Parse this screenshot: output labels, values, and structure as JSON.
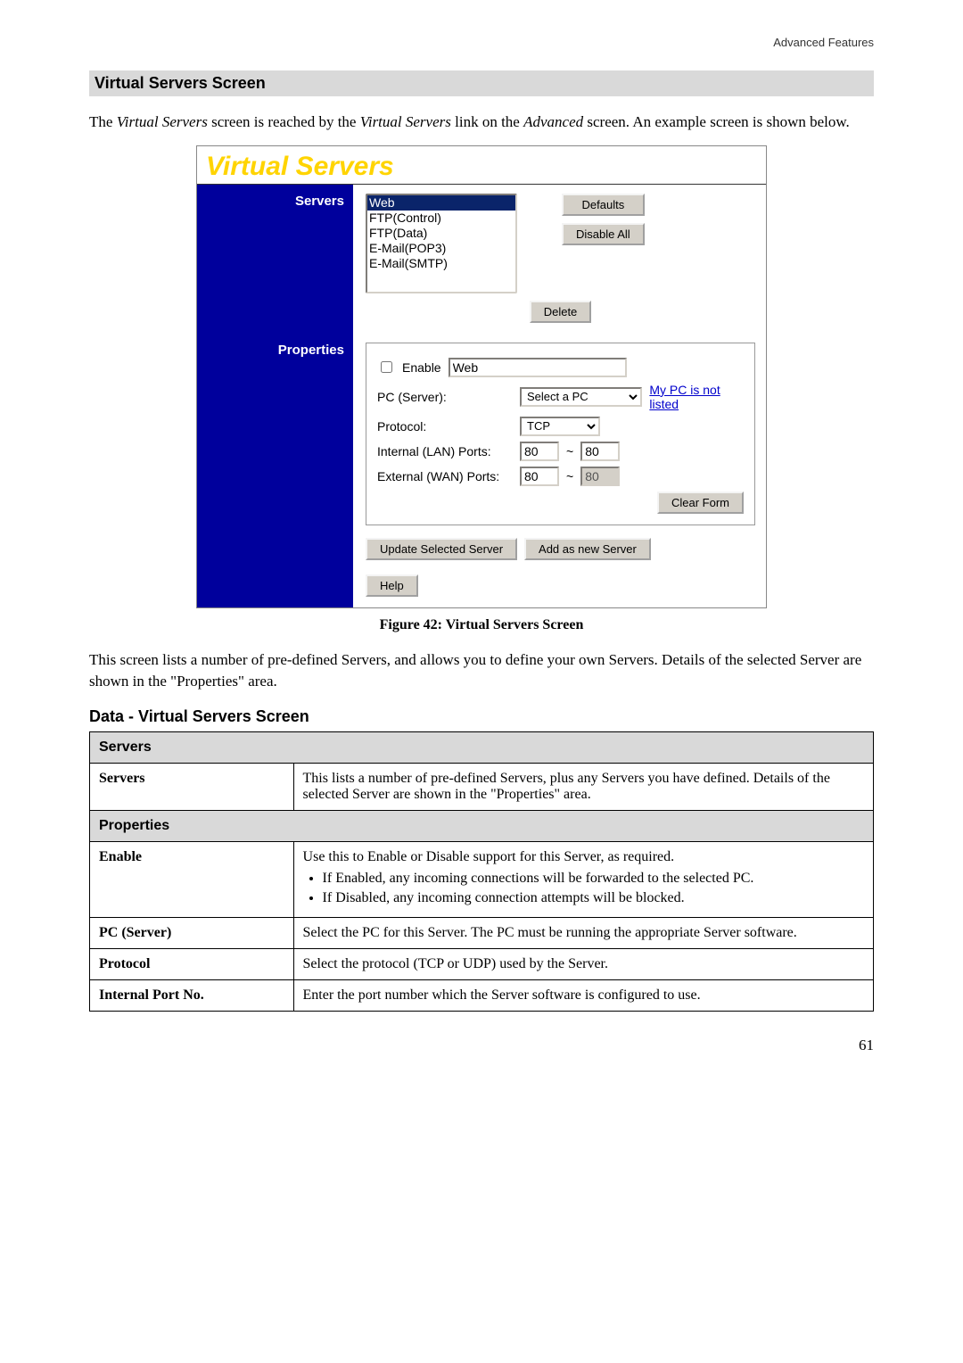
{
  "header": {
    "breadcrumb": "Advanced Features"
  },
  "section": {
    "title": "Virtual Servers Screen"
  },
  "intro": {
    "p1_pre": "The ",
    "p1_vs1": "Virtual Servers",
    "p1_mid1": " screen is reached by the ",
    "p1_vs2": "Virtual Servers",
    "p1_mid2": " link on the ",
    "p1_adv": "Advanced",
    "p1_end": " screen. An example screen is shown below."
  },
  "router": {
    "title": "Virtual Servers",
    "labels": {
      "servers": "Servers",
      "properties": "Properties"
    },
    "serverList": [
      "Web",
      "FTP(Control)",
      "FTP(Data)",
      "E-Mail(POP3)",
      "E-Mail(SMTP)"
    ],
    "buttons": {
      "defaults": "Defaults",
      "disableAll": "Disable All",
      "delete": "Delete",
      "clearForm": "Clear Form",
      "updateSel": "Update Selected Server",
      "addNew": "Add as new Server",
      "help": "Help"
    },
    "props": {
      "enableLabel": "Enable",
      "enableName": "Web",
      "pcServerLabel": "PC (Server):",
      "pcSelect": "Select a PC",
      "pcLink": "My PC is not listed",
      "protocolLabel": "Protocol:",
      "protocolValue": "TCP",
      "internalPortsLabel": "Internal (LAN) Ports:",
      "internalPort1": "80",
      "internalPort2": "80",
      "externalPortsLabel": "External (WAN) Ports:",
      "externalPort1": "80",
      "externalPort2": "80",
      "tilde": "~"
    }
  },
  "figure": {
    "caption": "Figure 42: Virtual Servers Screen"
  },
  "post": {
    "p2": "This screen lists a number of pre-defined Servers, and allows you to define your own Servers. Details of the selected Server are shown in the \"Properties\" area."
  },
  "dataHeading": "Data - Virtual Servers Screen",
  "table": {
    "group1": "Servers",
    "row1": {
      "name": "Servers",
      "desc": "This lists a number of pre-defined Servers, plus any Servers you have defined. Details of the selected Server are shown in the \"Properties\" area."
    },
    "group2": "Properties",
    "row2": {
      "name": "Enable",
      "desc": "Use this to Enable or Disable support for this Server, as required.",
      "b1": "If Enabled, any incoming connections will be forwarded to the selected PC.",
      "b2": "If Disabled, any incoming connection attempts will be blocked."
    },
    "row3": {
      "name": "PC (Server)",
      "desc": "Select the PC for this Server. The PC must be running the appropriate Server software."
    },
    "row4": {
      "name": "Protocol",
      "desc": "Select the protocol (TCP or UDP) used by the Server."
    },
    "row5": {
      "name": "Internal Port No.",
      "desc": "Enter the port number which the Server software is configured to use."
    }
  },
  "pageNumber": "61"
}
